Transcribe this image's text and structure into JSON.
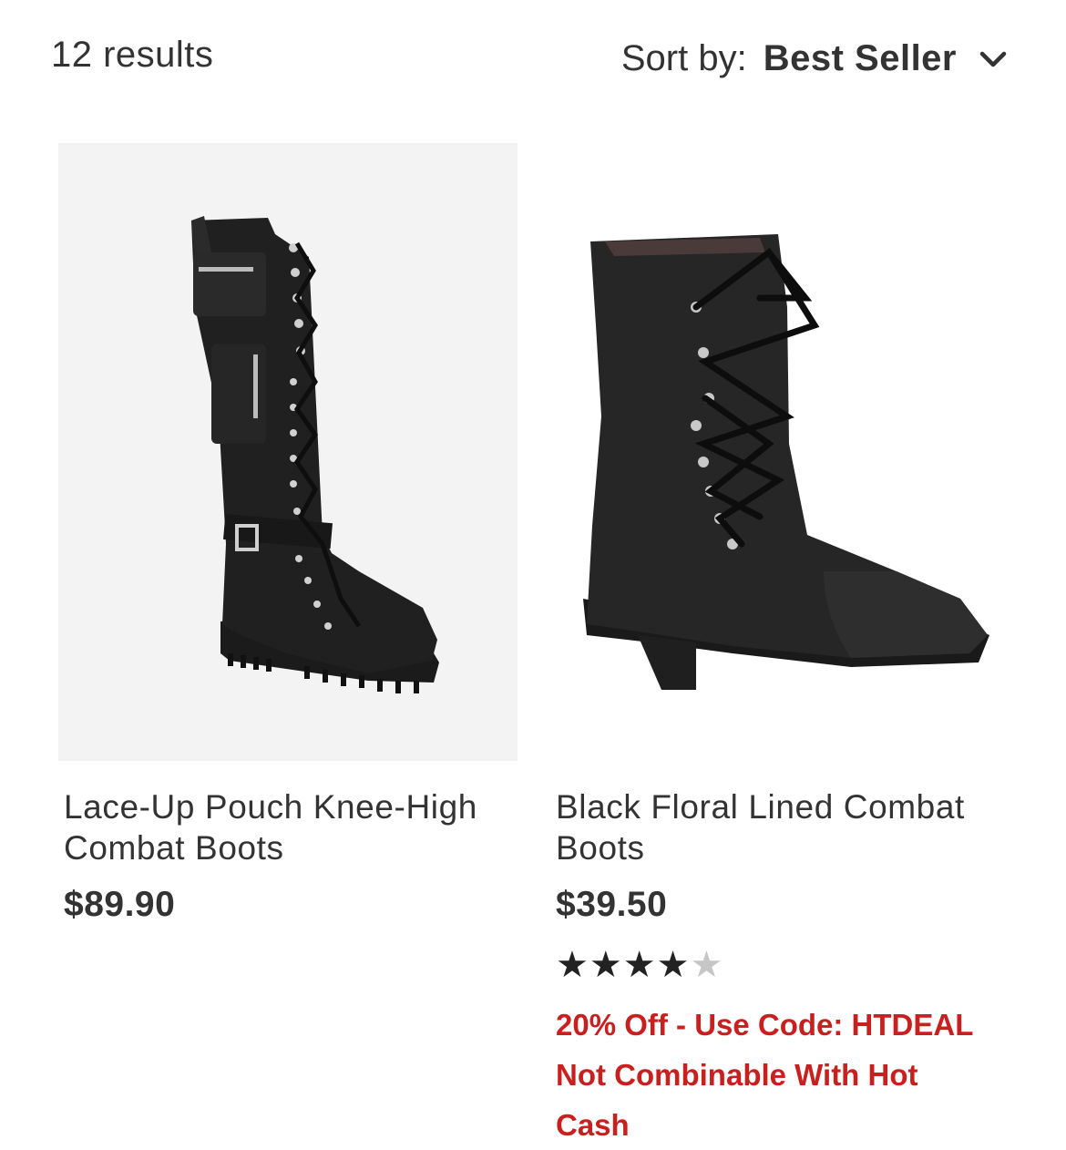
{
  "header": {
    "results_count": "12 results",
    "sort_label": "Sort by:",
    "sort_value": "Best Seller"
  },
  "products": [
    {
      "image_icon": "knee-high-boot-image",
      "title": "Lace-Up Pouch Knee-High Combat Boots",
      "price": "$89.90"
    },
    {
      "image_icon": "combat-boot-image",
      "title": "Black Floral Lined Combat Boots",
      "price": "$39.50",
      "rating": 4.5,
      "rating_max": 5,
      "promo_line1": "20% Off - Use Code: HTDEAL",
      "promo_line2": "Not Combinable With Hot Cash"
    }
  ],
  "colors": {
    "promo": "#c8201f",
    "text": "#333333",
    "star_filled": "#222222",
    "star_empty": "#c6c6c6"
  }
}
